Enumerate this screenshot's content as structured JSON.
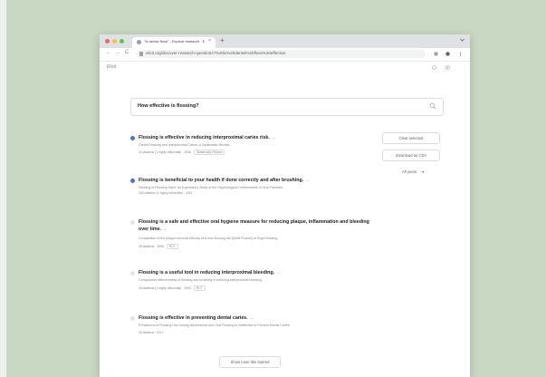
{
  "colors": {
    "backdrop": "#c9d8c2",
    "close_dot": "#ed6a5e",
    "min_dot": "#f5bf4f",
    "max_dot": "#61c554",
    "selected_check": "#4a73d8",
    "unselected_check": "#e3e5e8"
  },
  "browser": {
    "tab_title": "\"Is dental floss\" - Explore research · E",
    "tab_close": "×",
    "new_tab": "+",
    "back": "←",
    "forward": "→",
    "reload": "C",
    "url": "elicit.org/discover-research-questions?%20is%20dental%20floss%20effective"
  },
  "app": {
    "brand": "Elicit"
  },
  "search": {
    "query": "How effective is flossing?"
  },
  "claims": [
    {
      "title": "Flossing is effective in reducing interproximal caries risk.",
      "more": "→",
      "source": "Caries Flossing and Interproximal Caries: a Systematic Review",
      "meta": "23 citations (1 highly influential) · 2006",
      "tags": [
        "Systematic Review"
      ],
      "selected": true
    },
    {
      "title": "Flossing is beneficial to your health if done correctly and after brushing.",
      "more": "→",
      "source": "Sending of Flossing Habit: an Exploratory Study of the Psychological Determinants of Oral Practices",
      "meta": "118 citations (1 highly influential) · 2011",
      "tags": [],
      "selected": true
    },
    {
      "title": "Flossing is a safe and effective oral hygiene measure for reducing plaque, inflammation and bleeding over time.",
      "more": "→",
      "source": "Comparison of the plaque removal efficacy of a new flossing aid (Dentl Flosser) to finger flossing",
      "meta": "18 citations · 1998",
      "tags": [
        "RCT"
      ],
      "selected": false
    },
    {
      "title": "Flossing is a useful tool in reducing interproximal bleeding.",
      "more": "→",
      "source": "Comparative effectiveness of flossing and brushing in reducing interproximal bleeding",
      "meta": "18 citations (1 highly influential) · 2003",
      "tags": [
        "RCT"
      ],
      "selected": false
    },
    {
      "title": "Flossing is effective in preventing dental caries.",
      "more": "→",
      "source": "Prevalence of Flossing Use Among Adolescents and Oral Flossing is Ineffective to Prevent Dental Caries",
      "meta": "15 citations · 2017",
      "tags": [],
      "selected": false
    }
  ],
  "sidebar_actions": {
    "clear": "Clear selected",
    "download": "Download as CSV",
    "filter": "All years",
    "filter_chevron": "▾"
  },
  "footer": {
    "show_more": "Show more like starred"
  }
}
